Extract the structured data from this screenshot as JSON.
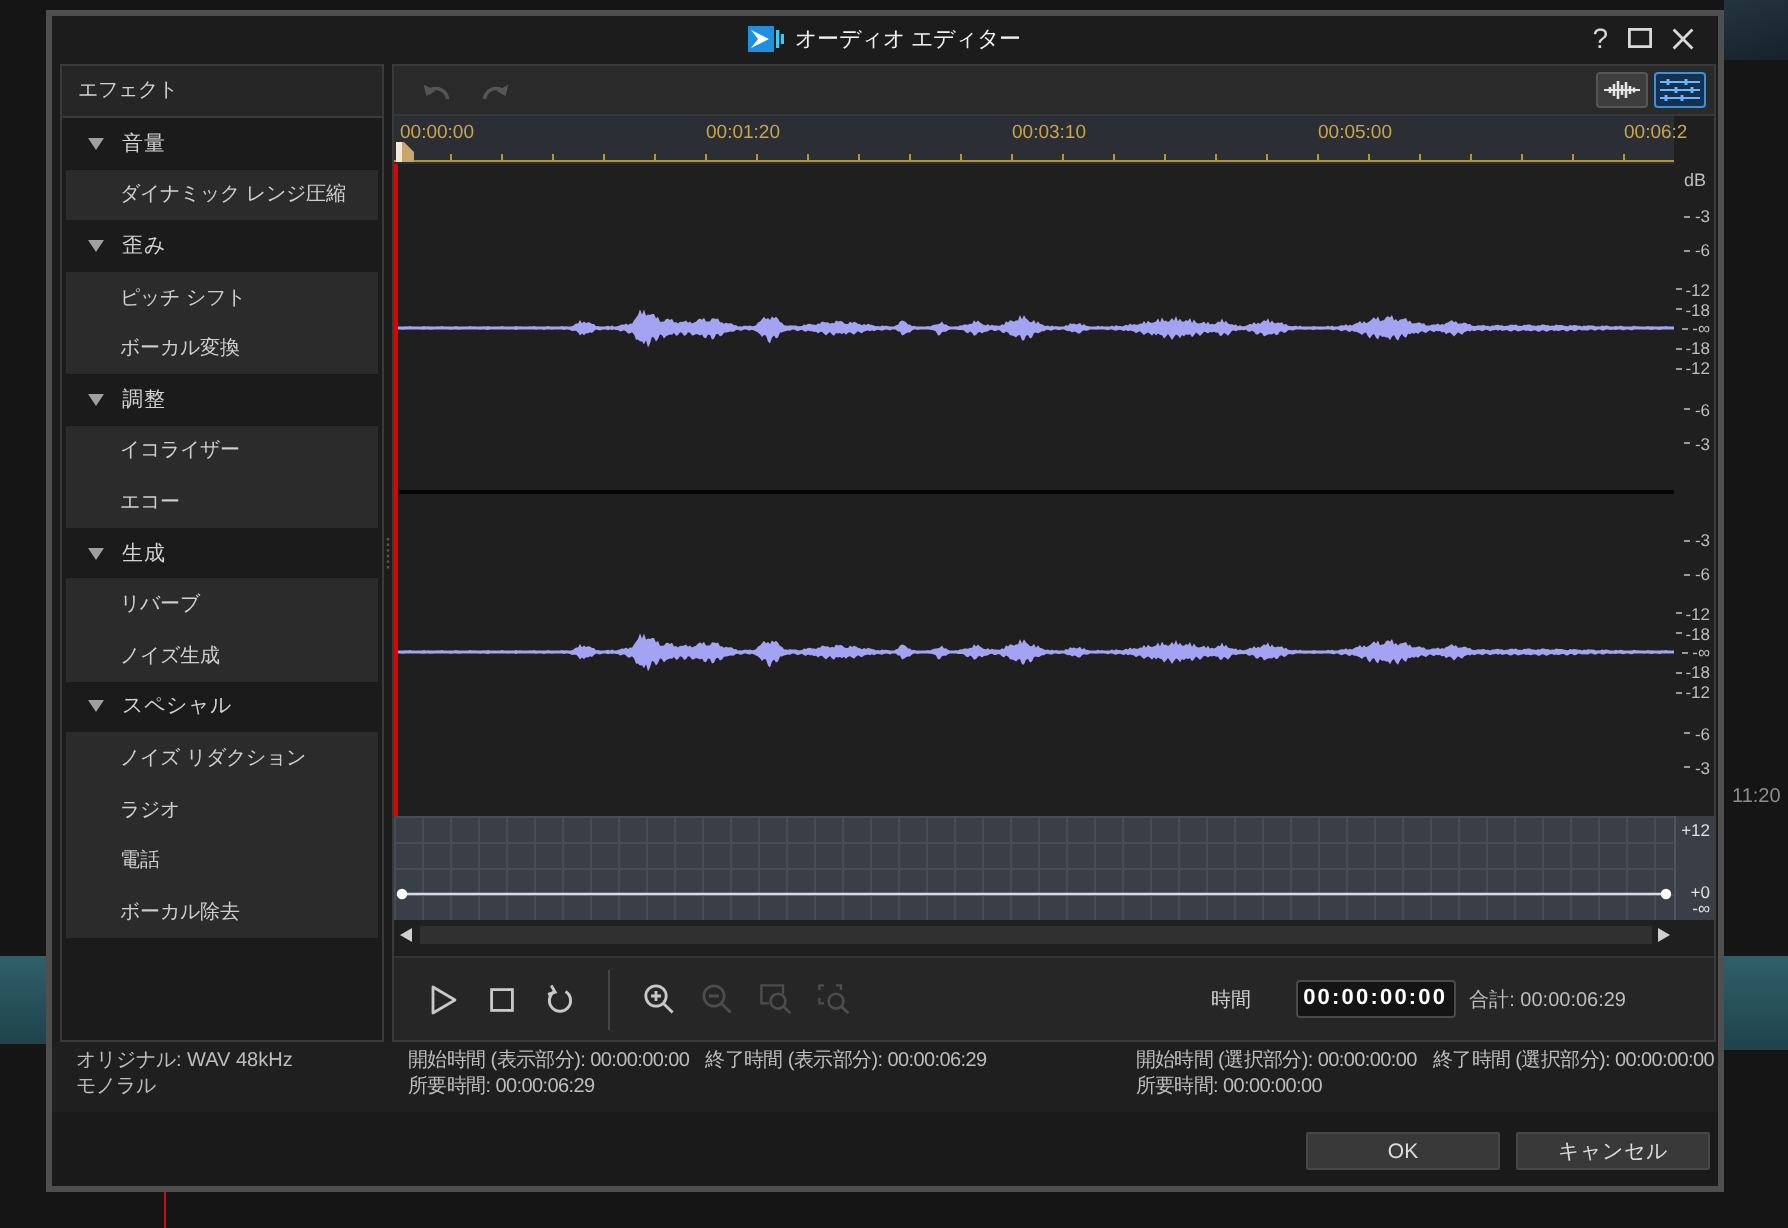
{
  "window": {
    "title": "オーディオ エディター",
    "help_label": "?"
  },
  "background": {
    "timeline_time": "11:20"
  },
  "effects_panel": {
    "title": "エフェクト",
    "groups": [
      {
        "label": "音量",
        "expanded": true,
        "children": [
          {
            "label": "ダイナミック レンジ圧縮"
          }
        ]
      },
      {
        "label": "歪み",
        "expanded": true,
        "children": [
          {
            "label": "ピッチ シフト"
          },
          {
            "label": "ボーカル変換"
          }
        ]
      },
      {
        "label": "調整",
        "expanded": true,
        "children": [
          {
            "label": "イコライザー"
          },
          {
            "label": "エコー"
          }
        ]
      },
      {
        "label": "生成",
        "expanded": true,
        "children": [
          {
            "label": "リバーブ"
          },
          {
            "label": "ノイズ生成"
          }
        ]
      },
      {
        "label": "スペシャル",
        "expanded": true,
        "children": [
          {
            "label": "ノイズ リダクション"
          },
          {
            "label": "ラジオ"
          },
          {
            "label": "電話"
          },
          {
            "label": "ボーカル除去"
          }
        ]
      }
    ]
  },
  "toolbar": {
    "history_buttons": [
      {
        "kind": "undo",
        "disabled": true
      },
      {
        "kind": "redo",
        "disabled": true
      }
    ],
    "view_buttons": [
      {
        "kind": "waveform",
        "selected": false
      },
      {
        "kind": "tracks",
        "selected": true
      }
    ]
  },
  "ruler": {
    "labels": [
      "00:00:00",
      "00:01:20",
      "00:03:10",
      "00:05:00",
      "00:06:2"
    ]
  },
  "waveform": {
    "unit": "dB",
    "channels": [
      {
        "scale": [
          "-3",
          "-6",
          "-12",
          "-18",
          "-∞",
          "-18",
          "-12",
          "-6",
          "-3"
        ]
      },
      {
        "scale": [
          "-3",
          "-6",
          "-12",
          "-18",
          "-∞",
          "-18",
          "-12",
          "-6",
          "-3"
        ]
      }
    ]
  },
  "volume_envelope": {
    "scale": [
      "+12",
      "+0",
      "-∞"
    ]
  },
  "transport": {
    "buttons": [
      {
        "kind": "play",
        "disabled": false
      },
      {
        "kind": "stop",
        "disabled": false
      },
      {
        "kind": "loop",
        "disabled": false
      }
    ],
    "zoom_buttons": [
      {
        "kind": "zoom_in",
        "disabled": false
      },
      {
        "kind": "zoom_out",
        "disabled": true
      },
      {
        "kind": "zoom_selection",
        "disabled": true
      },
      {
        "kind": "zoom_fit",
        "disabled": true
      }
    ],
    "time_label": "時間",
    "time_value": "00:00:00:00",
    "total": "合計: 00:00:06:29"
  },
  "status": {
    "source": [
      "オリジナル: WAV 48kHz",
      "モノラル"
    ],
    "view_range": {
      "start": "開始時間 (表示部分): 00:00:00:00",
      "end": "終了時間 (表示部分): 00:00:06:29",
      "duration": "所要時間: 00:00:06:29"
    },
    "selection_range": {
      "start": "開始時間 (選択部分): 00:00:00:00",
      "end": "終了時間 (選択部分): 00:00:00:00",
      "duration": "所要時間: 00:00:00:00"
    }
  },
  "buttons": [
    "OK",
    "キャンセル"
  ]
}
